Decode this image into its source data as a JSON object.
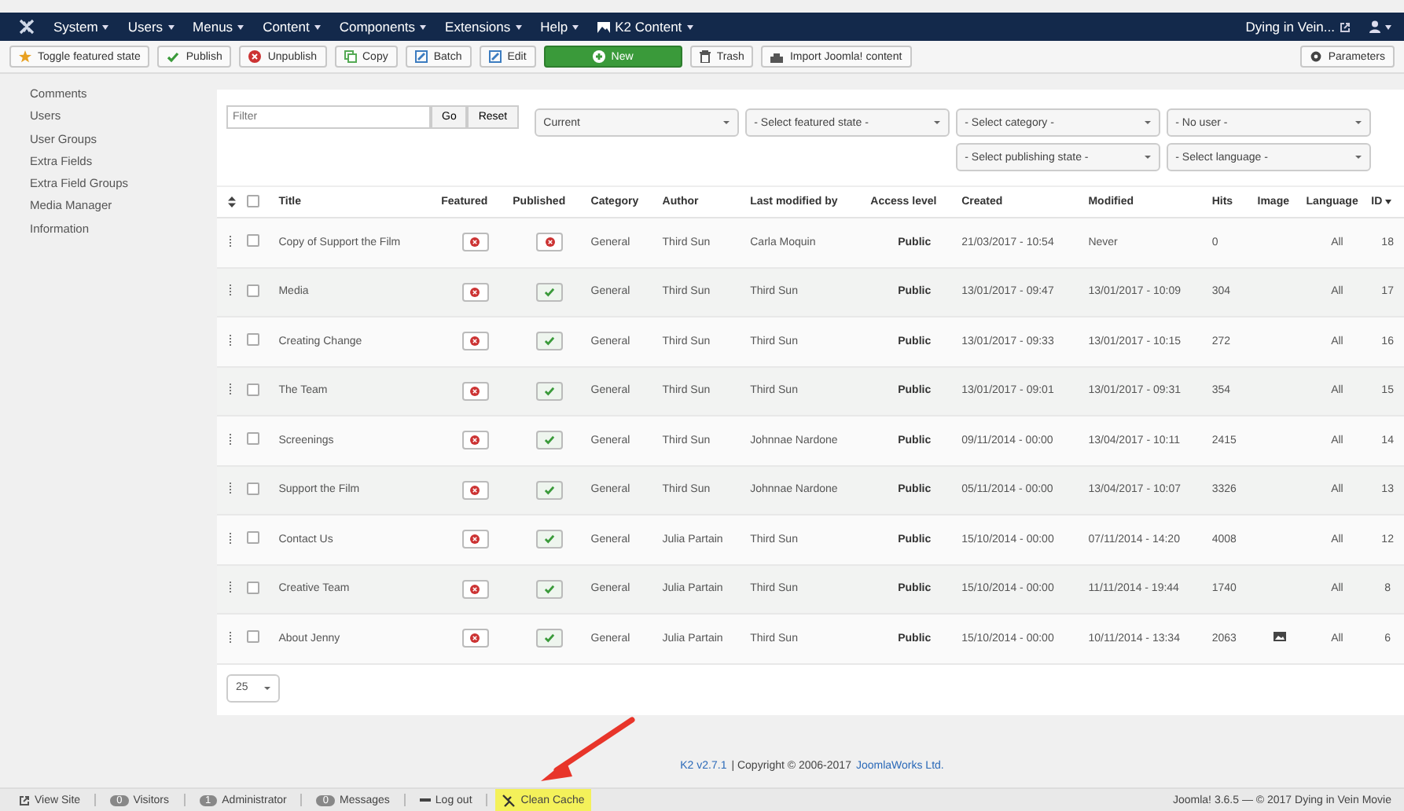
{
  "navbar": {
    "menus": [
      {
        "label": "System"
      },
      {
        "label": "Users"
      },
      {
        "label": "Menus"
      },
      {
        "label": "Content"
      },
      {
        "label": "Components"
      },
      {
        "label": "Extensions"
      },
      {
        "label": "Help"
      },
      {
        "label": "K2 Content"
      }
    ],
    "site": "Dying in Vein..."
  },
  "toolbar": {
    "buttons": [
      {
        "kind": "star",
        "label": "Toggle featured state"
      },
      {
        "kind": "check",
        "label": "Publish"
      },
      {
        "kind": "unpublish",
        "label": "Unpublish"
      },
      {
        "kind": "copy",
        "label": "Copy"
      },
      {
        "kind": "edit",
        "label": "Batch"
      },
      {
        "kind": "edit",
        "label": "Edit"
      },
      {
        "kind": "new",
        "label": "New"
      },
      {
        "kind": "trash",
        "label": "Trash"
      },
      {
        "kind": "import",
        "label": "Import Joomla! content"
      }
    ],
    "parameters": "Parameters"
  },
  "sidebar": {
    "items": [
      "Comments",
      "Users",
      "User Groups",
      "Extra Fields",
      "Extra Field Groups",
      "Media Manager",
      "Information"
    ]
  },
  "filters": {
    "search": {
      "placeholder": "Filter"
    },
    "go": "Go",
    "reset": "Reset",
    "selects": [
      "Current",
      "- Select featured state -",
      "- Select category -",
      "- No user -",
      "- Select publishing state -",
      "- Select language -"
    ]
  },
  "table": {
    "all_checked": false,
    "columns": [
      "Title",
      "Featured",
      "Published",
      "Category",
      "Author",
      "Last modified by",
      "Access level",
      "Created",
      "Modified",
      "Hits",
      "Image",
      "Language",
      "ID"
    ],
    "rows": [
      {
        "title": "Copy of Support the Film",
        "checked": false,
        "featured": false,
        "published": false,
        "category": "General",
        "author": "Third Sun",
        "modified_by": "Carla Moquin",
        "access": "Public",
        "created": "21/03/2017 - 10:54",
        "modified": "Never",
        "hits": "0",
        "has_image": false,
        "language": "All",
        "id": "18"
      },
      {
        "title": "Media",
        "checked": false,
        "featured": false,
        "published": true,
        "category": "General",
        "author": "Third Sun",
        "modified_by": "Third Sun",
        "access": "Public",
        "created": "13/01/2017 - 09:47",
        "modified": "13/01/2017 - 10:09",
        "hits": "304",
        "has_image": false,
        "language": "All",
        "id": "17"
      },
      {
        "title": "Creating Change",
        "checked": false,
        "featured": false,
        "published": true,
        "category": "General",
        "author": "Third Sun",
        "modified_by": "Third Sun",
        "access": "Public",
        "created": "13/01/2017 - 09:33",
        "modified": "13/01/2017 - 10:15",
        "hits": "272",
        "has_image": false,
        "language": "All",
        "id": "16"
      },
      {
        "title": "The Team",
        "checked": false,
        "featured": false,
        "published": true,
        "category": "General",
        "author": "Third Sun",
        "modified_by": "Third Sun",
        "access": "Public",
        "created": "13/01/2017 - 09:01",
        "modified": "13/01/2017 - 09:31",
        "hits": "354",
        "has_image": false,
        "language": "All",
        "id": "15"
      },
      {
        "title": "Screenings",
        "checked": false,
        "featured": false,
        "published": true,
        "category": "General",
        "author": "Third Sun",
        "modified_by": "Johnnae Nardone",
        "access": "Public",
        "created": "09/11/2014 - 00:00",
        "modified": "13/04/2017 - 10:11",
        "hits": "2415",
        "has_image": false,
        "language": "All",
        "id": "14"
      },
      {
        "title": "Support the Film",
        "checked": false,
        "featured": false,
        "published": true,
        "category": "General",
        "author": "Third Sun",
        "modified_by": "Johnnae Nardone",
        "access": "Public",
        "created": "05/11/2014 - 00:00",
        "modified": "13/04/2017 - 10:07",
        "hits": "3326",
        "has_image": false,
        "language": "All",
        "id": "13"
      },
      {
        "title": "Contact Us",
        "checked": false,
        "featured": false,
        "published": true,
        "category": "General",
        "author": "Julia Partain",
        "modified_by": "Third Sun",
        "access": "Public",
        "created": "15/10/2014 - 00:00",
        "modified": "07/11/2014 - 14:20",
        "hits": "4008",
        "has_image": false,
        "language": "All",
        "id": "12"
      },
      {
        "title": "Creative Team",
        "checked": false,
        "featured": false,
        "published": true,
        "category": "General",
        "author": "Julia Partain",
        "modified_by": "Third Sun",
        "access": "Public",
        "created": "15/10/2014 - 00:00",
        "modified": "11/11/2014 - 19:44",
        "hits": "1740",
        "has_image": false,
        "language": "All",
        "id": "8"
      },
      {
        "title": "About Jenny",
        "checked": false,
        "featured": false,
        "published": true,
        "category": "General",
        "author": "Julia Partain",
        "modified_by": "Third Sun",
        "access": "Public",
        "created": "15/10/2014 - 00:00",
        "modified": "10/11/2014 - 13:34",
        "hits": "2063",
        "has_image": true,
        "language": "All",
        "id": "6"
      }
    ]
  },
  "pagination": {
    "limit": "25"
  },
  "footer": {
    "version_link": "K2 v2.7.1",
    "copyright": "| Copyright © 2006-2017",
    "company_link": "JoomlaWorks Ltd."
  },
  "status_bar": {
    "items": [
      {
        "kind": "link",
        "label": "View Site",
        "highlighted": false
      },
      {
        "kind": "count",
        "count": "0",
        "label": "Visitors",
        "highlighted": false
      },
      {
        "kind": "count",
        "count": "1",
        "label": "Administrator",
        "highlighted": false
      },
      {
        "kind": "count",
        "count": "0",
        "label": "Messages",
        "highlighted": false
      },
      {
        "kind": "logout",
        "label": "Log out",
        "highlighted": false
      },
      {
        "kind": "cache",
        "label": "Clean Cache",
        "highlighted": true
      }
    ],
    "version": "Joomla! 3.6.5  —  © 2017 Dying in Vein Movie"
  }
}
